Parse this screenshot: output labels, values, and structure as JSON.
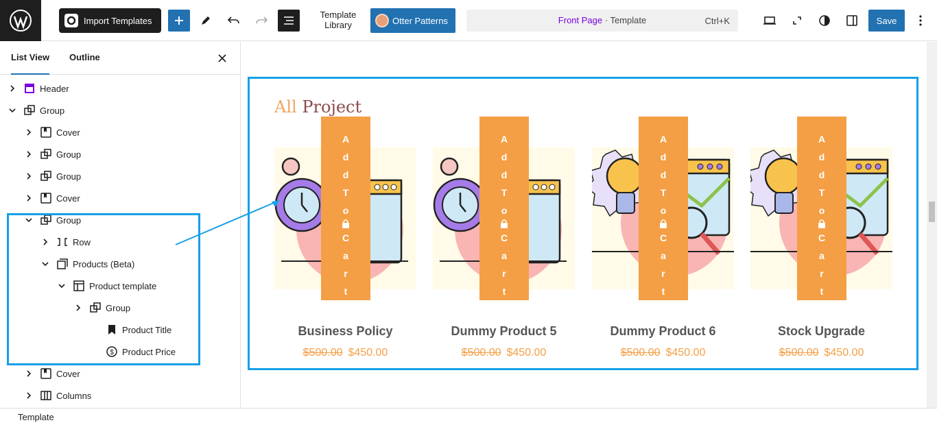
{
  "topbar": {
    "import_label": "Import Templates",
    "template_library_label": "Template Library",
    "otter_label": "Otter Patterns",
    "command": {
      "page": "Front Page",
      "separator": " · ",
      "type": "Template",
      "shortcut": "Ctrl+K"
    },
    "save_label": "Save"
  },
  "sidebar": {
    "tabs": [
      "List View",
      "Outline"
    ],
    "items": [
      {
        "label": "Header",
        "icon": "template-part-icon"
      },
      {
        "label": "Group",
        "icon": "group-icon"
      },
      {
        "label": "Cover",
        "icon": "cover-icon"
      },
      {
        "label": "Group",
        "icon": "group-icon"
      },
      {
        "label": "Group",
        "icon": "group-icon"
      },
      {
        "label": "Cover",
        "icon": "cover-icon"
      },
      {
        "label": "Group",
        "icon": "group-icon"
      },
      {
        "label": "Row",
        "icon": "row-icon"
      },
      {
        "label": "Products (Beta)",
        "icon": "products-icon"
      },
      {
        "label": "Product template",
        "icon": "layout-icon"
      },
      {
        "label": "Group",
        "icon": "group-icon"
      },
      {
        "label": "Product Title",
        "icon": "bookmark-icon"
      },
      {
        "label": "Product Price",
        "icon": "price-icon"
      },
      {
        "label": "Cover",
        "icon": "cover-icon"
      },
      {
        "label": "Columns",
        "icon": "columns-icon"
      }
    ]
  },
  "canvas": {
    "section_title_a": "All",
    "section_title_b": "Project",
    "cart_text": "AddToCart",
    "products": [
      {
        "name": "Business Policy",
        "old_price": "$500.00",
        "price": "$450.00",
        "art": "stopwatch"
      },
      {
        "name": "Dummy Product 5",
        "old_price": "$500.00",
        "price": "$450.00",
        "art": "stopwatch"
      },
      {
        "name": "Dummy Product 6",
        "old_price": "$500.00",
        "price": "$450.00",
        "art": "bulb"
      },
      {
        "name": "Stock Upgrade",
        "old_price": "$500.00",
        "price": "$450.00",
        "art": "bulb"
      }
    ]
  },
  "footer": {
    "label": "Template"
  },
  "colors": {
    "accent": "#2271b1",
    "highlight": "#16a0e6",
    "orange": "#f49f45",
    "purple": "#7a00df"
  }
}
